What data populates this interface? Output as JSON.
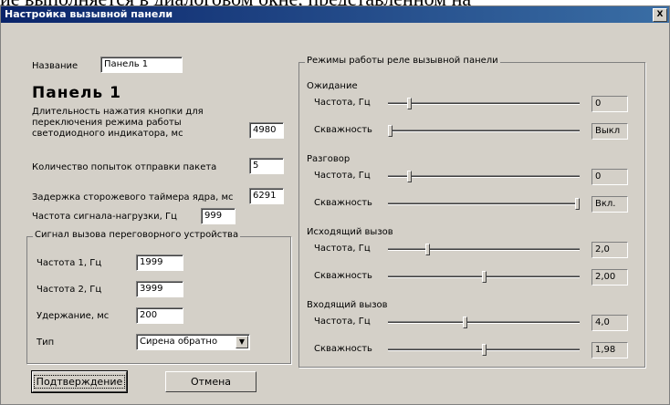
{
  "background_text": "ие выполняется в диалоговом окне, представленном на",
  "window": {
    "title": "Настройка вызывной панели",
    "close_glyph": "X"
  },
  "name_field": {
    "label": "Название",
    "value": "Панель 1"
  },
  "panel_heading": "Панель  1",
  "press_duration": {
    "label_lines": [
      "Длительность нажатия кнопки для",
      "переключения режима работы",
      "светодиодного индикатора, мс"
    ],
    "value": "4980"
  },
  "send_attempts": {
    "label": "Количество попыток отправки пакета",
    "value": "5"
  },
  "watchdog": {
    "label": "Задержка сторожевого таймера ядра, мс",
    "value": "6291"
  },
  "load_freq": {
    "label": "Частота сигнала-нагрузки, Гц",
    "value": "999"
  },
  "call_signal": {
    "title": "Сигнал вызова переговорного устройства",
    "freq1": {
      "label": "Частота 1, Гц",
      "value": "1999"
    },
    "freq2": {
      "label": "Частота 2, Гц",
      "value": "3999"
    },
    "hold": {
      "label": "Удержание, мс",
      "value": "200"
    },
    "type": {
      "label": "Тип",
      "value": "Сирена обратно"
    }
  },
  "relay_modes": {
    "title": "Режимы работы реле вызывной панели",
    "freq_label": "Частота, Гц",
    "duty_label": "Скважность",
    "modes": [
      {
        "name": "Ожидание",
        "freq_value": "0",
        "freq_pos": 0.1,
        "duty_value": "Выкл",
        "duty_pos": 0.0
      },
      {
        "name": "Разговор",
        "freq_value": "0",
        "freq_pos": 0.1,
        "duty_value": "Вкл.",
        "duty_pos": 1.0
      },
      {
        "name": "Исходящий вызов",
        "freq_value": "2,0",
        "freq_pos": 0.2,
        "duty_value": "2,00",
        "duty_pos": 0.5
      },
      {
        "name": "Входящий вызов",
        "freq_value": "4,0",
        "freq_pos": 0.4,
        "duty_value": "1,98",
        "duty_pos": 0.5
      }
    ]
  },
  "buttons": {
    "confirm": "Подтверждение",
    "cancel": "Отмена"
  }
}
